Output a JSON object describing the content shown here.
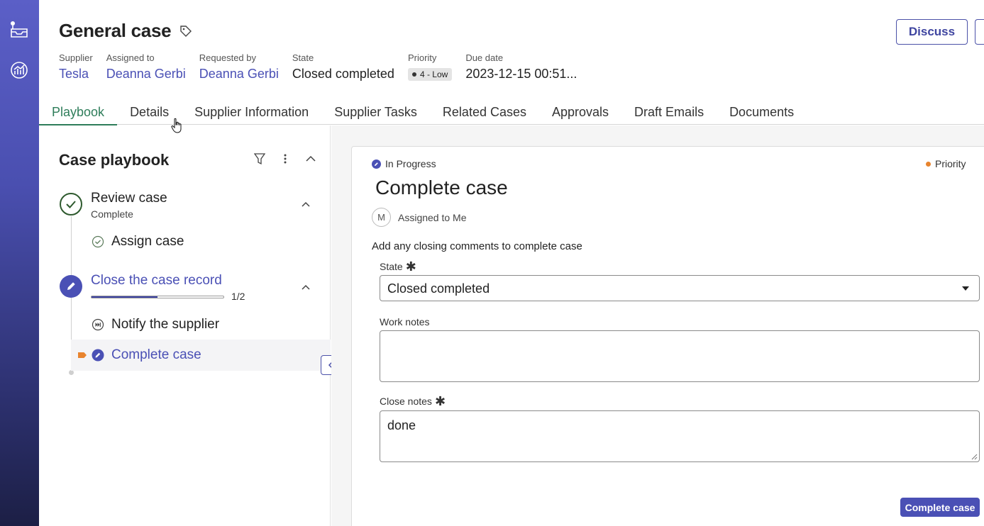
{
  "header": {
    "title": "General case",
    "discuss_label": "Discuss",
    "meta": {
      "supplier_label": "Supplier",
      "supplier_value": "Tesla",
      "assigned_label": "Assigned to",
      "assigned_value": "Deanna Gerbi",
      "requested_label": "Requested by",
      "requested_value": "Deanna Gerbi",
      "state_label": "State",
      "state_value": "Closed completed",
      "priority_label": "Priority",
      "priority_value": "4 - Low",
      "due_label": "Due date",
      "due_value": "2023-12-15 00:51..."
    }
  },
  "tabs": [
    "Playbook",
    "Details",
    "Supplier Information",
    "Supplier Tasks",
    "Related Cases",
    "Approvals",
    "Draft Emails",
    "Documents"
  ],
  "playbook": {
    "title": "Case playbook",
    "stage1": {
      "title": "Review case",
      "subtitle": "Complete",
      "task": "Assign case"
    },
    "stage2": {
      "title": "Close the case record",
      "progress": "1/2",
      "progress_fraction": 0.5,
      "task1": "Notify the supplier",
      "task2": "Complete case"
    }
  },
  "card": {
    "status": "In Progress",
    "priority": "Priority",
    "title": "Complete case",
    "avatar_initial": "M",
    "assigned": "Assigned to Me",
    "instruction": "Add any closing comments to complete case",
    "state_label": "State",
    "state_value": "Closed completed",
    "work_notes_label": "Work notes",
    "work_notes_value": "",
    "close_notes_label": "Close notes",
    "close_notes_value": "done",
    "complete_button": "Complete case"
  },
  "colors": {
    "brand": "#4a50b5",
    "active_tab": "#2e7d5a",
    "priority": "#e8842e",
    "complete": "#2e5a2e"
  }
}
